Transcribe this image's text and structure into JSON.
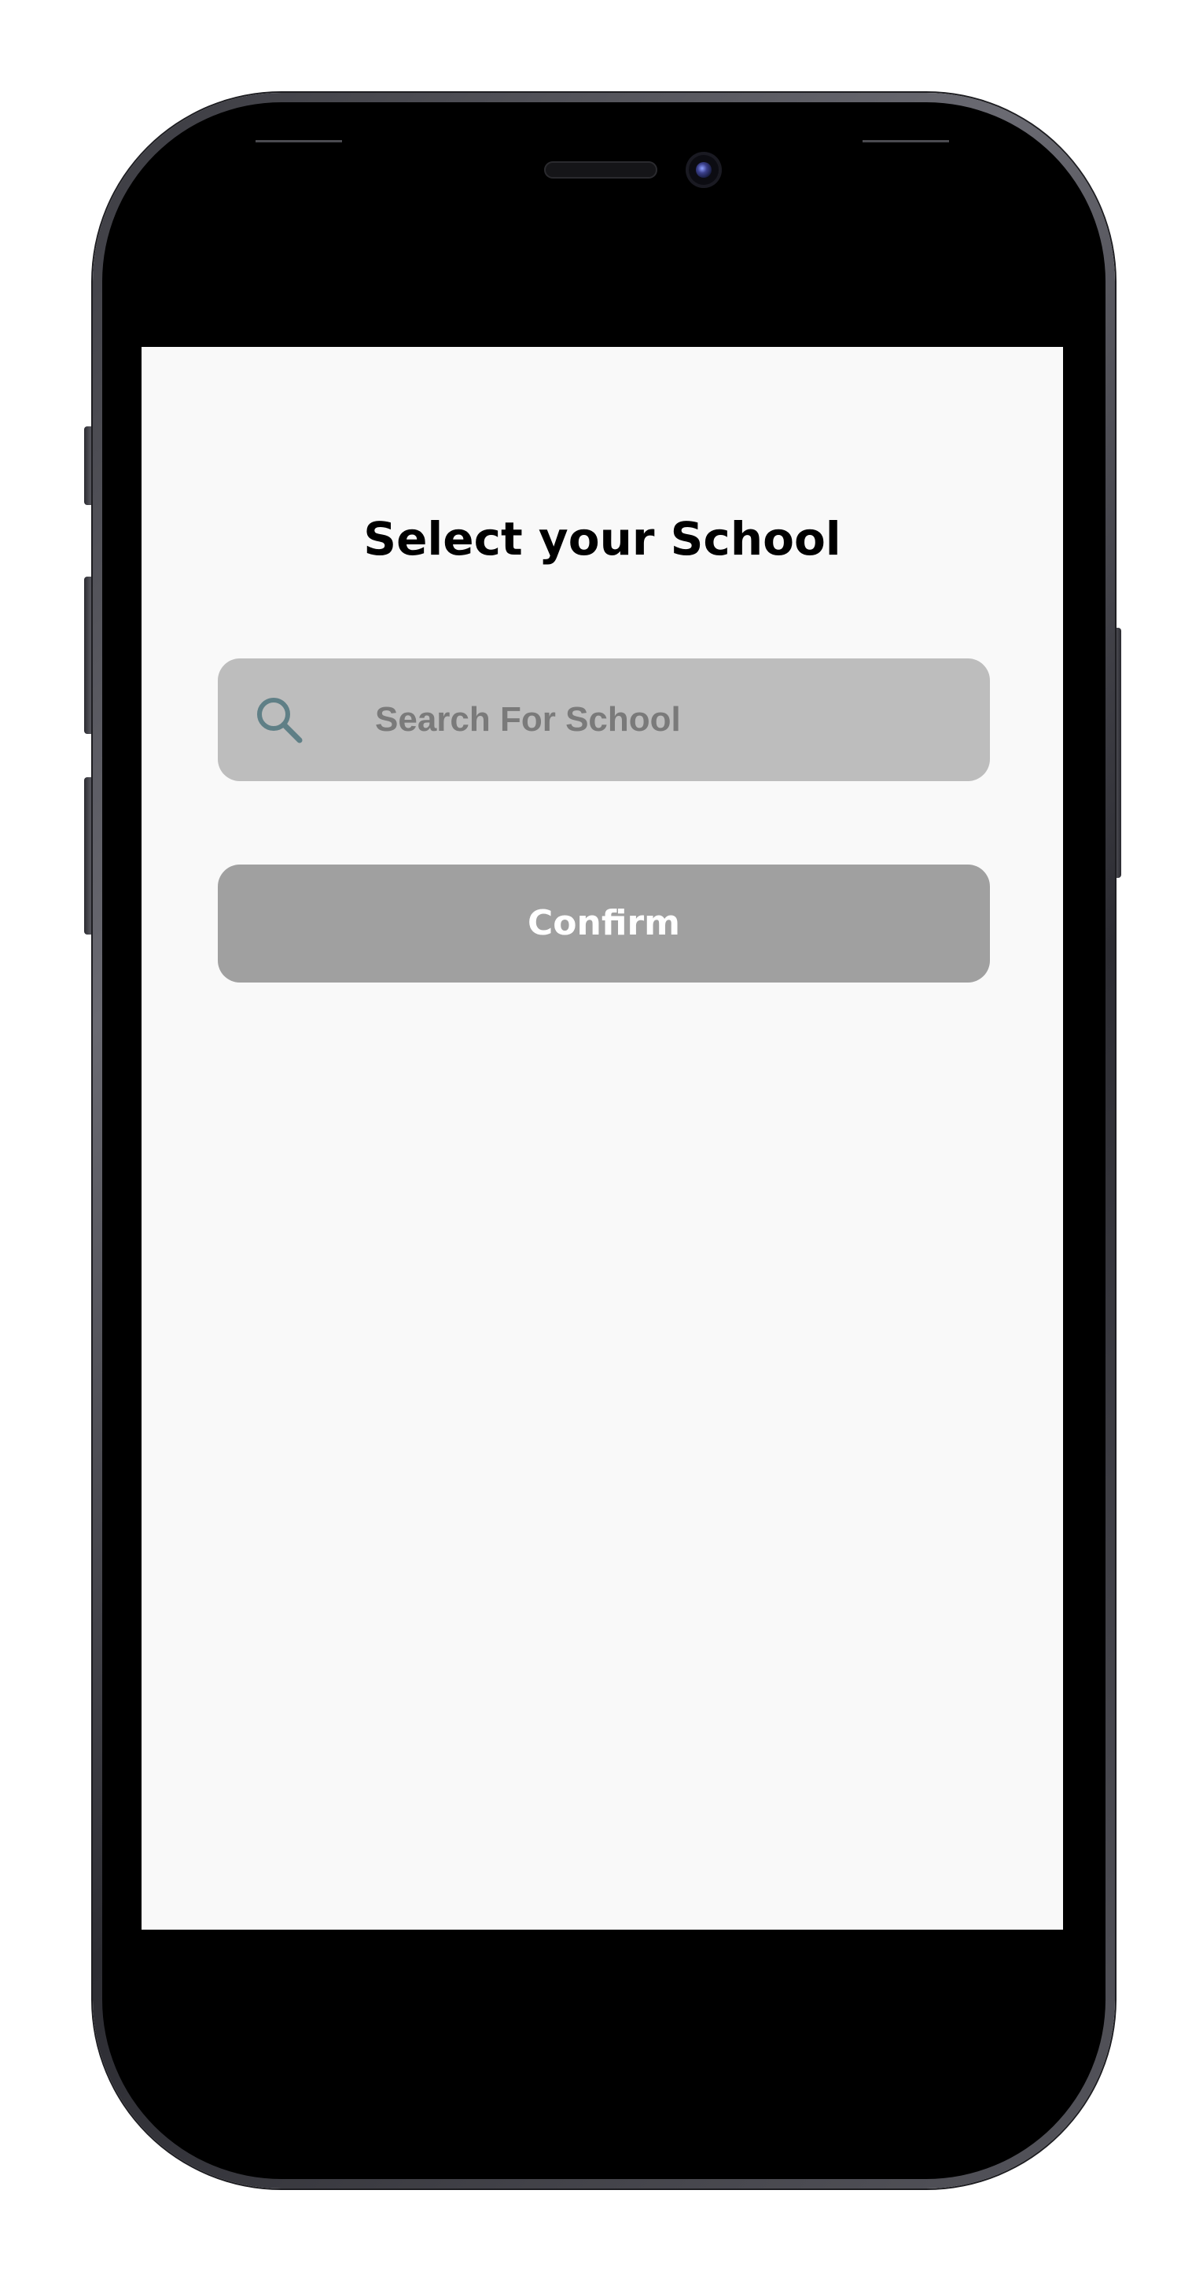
{
  "screen": {
    "title": "Select your School"
  },
  "search": {
    "placeholder": "Search For School",
    "value": "",
    "icon": "search-icon"
  },
  "actions": {
    "confirm_label": "Confirm"
  },
  "colors": {
    "screen_background": "#f9f9f9",
    "search_background": "#bdbdbd",
    "search_icon": "#5f7f86",
    "confirm_background": "#a0a0a0",
    "confirm_text": "#ffffff",
    "title_text": "#000000"
  }
}
